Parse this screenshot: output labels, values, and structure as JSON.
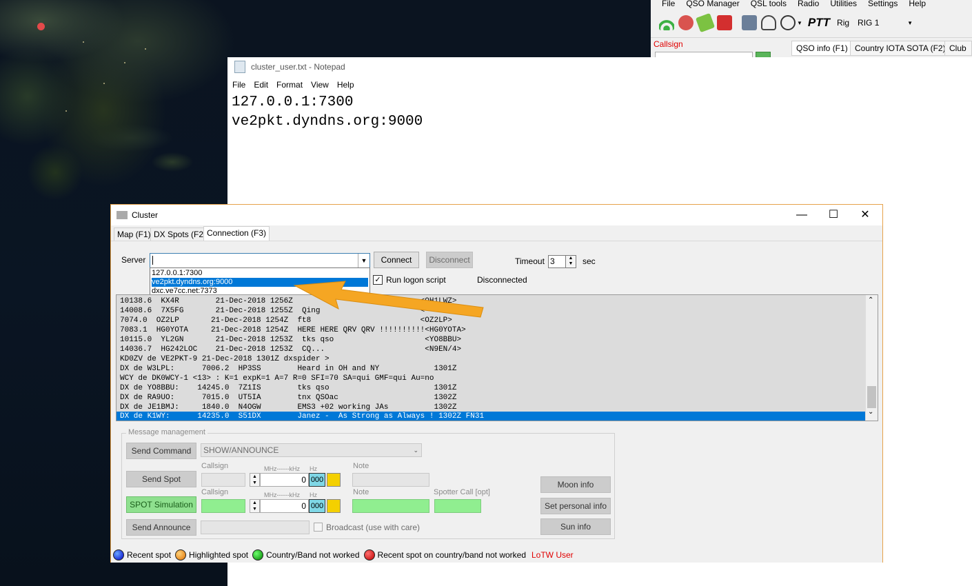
{
  "app": {
    "menu": [
      "File",
      "QSO Manager",
      "QSL tools",
      "Radio",
      "Utilities",
      "Settings",
      "Help"
    ],
    "ptt_label": "PTT",
    "rig_label": "Rig",
    "rig_value": "RIG 1",
    "callsign_label": "Callsign",
    "tabs": [
      "QSO info (F1)",
      "Country IOTA SOTA (F2)",
      "Club a"
    ]
  },
  "notepad": {
    "title": "cluster_user.txt - Notepad",
    "menu": [
      "File",
      "Edit",
      "Format",
      "View",
      "Help"
    ],
    "lines": [
      "127.0.0.1:7300",
      "ve2pkt.dyndns.org:9000"
    ]
  },
  "cluster": {
    "title": "Cluster",
    "window_buttons": {
      "minimize": "—",
      "maximize": "☐",
      "close": "✕"
    },
    "tabs": [
      "Map (F1)",
      "DX Spots (F2)",
      "Connection (F3)"
    ],
    "server_label": "Server",
    "server_value": "",
    "server_options": [
      "127.0.0.1:7300",
      "ve2pkt.dyndns.org:9000",
      "dxc.ve7cc.net:7373"
    ],
    "selected_option_index": 1,
    "connect_label": "Connect",
    "disconnect_label": "Disconnect",
    "timeout_label": "Timeout",
    "timeout_value": "3",
    "timeout_unit": "sec",
    "run_logon_label": "Run logon script",
    "run_logon_checked": true,
    "status": "Disconnected",
    "log_lines": [
      "10138.6  KX4R        21-Dec-2018 1256Z                            <OH1LWZ>",
      "14008.6  7X5FG       21-Dec-2018 1255Z  Qing                      <      >",
      "7074.0  OZ2LP       21-Dec-2018 1254Z  ft8                        <OZ2LP>",
      "7083.1  HG0YOTA     21-Dec-2018 1254Z  HERE HERE QRV QRV !!!!!!!!!!<HG0YOTA>",
      "10115.0  YL2GN       21-Dec-2018 1253Z  tks qso                    <YO8BBU>",
      "14036.7  HG242LOC    21-Dec-2018 1253Z  CQ...                      <N9EN/4>",
      "KD0ZV de VE2PKT-9 21-Dec-2018 1301Z dxspider >",
      "DX de W3LPL:      7006.2  HP3SS        Heard in OH and NY            1301Z",
      "WCY de DK0WCY-1 <13> : K=1 expK=1 A=7 R=0 SFI=70 SA=qui GMF=qui Au=no",
      "DX de YO8BBU:    14245.0  7Z1IS        tks qso                       1301Z",
      "DX de RA9UO:      7015.0  UT5IA        tnx QSOac                     1302Z",
      "DX de JE1BMJ:     1840.0  N4OGW        EMS3 +02 working JAs          1302Z",
      "DX de K1WY:      14235.0  S51DX        Janez -  As Strong as Always ! 1302Z FN31"
    ],
    "message_management": {
      "title": "Message management",
      "send_command_label": "Send Command",
      "command_value": "SHOW/ANNOUNCE",
      "send_spot_label": "Send Spot",
      "spot_simulation_label": "SPOT Simulation",
      "send_announce_label": "Send Announce",
      "callsign_label": "Callsign",
      "freq_label": "MHz------kHz",
      "hz_label": "Hz",
      "note_label": "Note",
      "spotter_label": "Spotter Call [opt]",
      "freq_value": "0",
      "hz_value": "000",
      "broadcast_label": "Broadcast (use with care)"
    },
    "side_buttons": [
      "Moon info",
      "Set personal info",
      "Sun info"
    ],
    "legend": {
      "recent": "Recent spot",
      "highlighted": "Highlighted spot",
      "not_worked": "Country/Band not worked",
      "recent_not_worked": "Recent spot on country/band not worked",
      "lotw": "LoTW User"
    },
    "colors": {
      "selection": "#0078d7",
      "arrow": "#f5a623",
      "green_field": "#90ee90",
      "lotw_text": "#e00000"
    }
  }
}
